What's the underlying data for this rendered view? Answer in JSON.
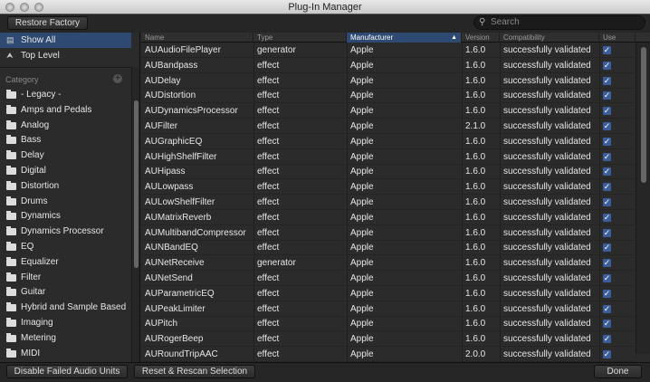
{
  "window": {
    "title": "Plug-In Manager"
  },
  "toolbar": {
    "restore_label": "Restore Factory",
    "search_placeholder": "Search"
  },
  "sidebar": {
    "top_items": [
      {
        "label": "Show All",
        "icon": "drive-icon"
      },
      {
        "label": "Top Level",
        "icon": "up-level-icon"
      }
    ],
    "category_label": "Category",
    "categories": [
      "- Legacy -",
      "Amps and Pedals",
      "Analog",
      "Bass",
      "Delay",
      "Digital",
      "Distortion",
      "Drums",
      "Dynamics",
      "Dynamics Processor",
      "EQ",
      "Equalizer",
      "Filter",
      "Guitar",
      "Hybrid and Sample Based",
      "Imaging",
      "Metering",
      "MIDI"
    ]
  },
  "table": {
    "columns": [
      "Name",
      "Type",
      "Manufacturer",
      "Version",
      "Compatibility",
      "Use"
    ],
    "sort_indicator": "▲",
    "rows": [
      [
        "AUAudioFilePlayer",
        "generator",
        "Apple",
        "1.6.0",
        "successfully validated"
      ],
      [
        "AUBandpass",
        "effect",
        "Apple",
        "1.6.0",
        "successfully validated"
      ],
      [
        "AUDelay",
        "effect",
        "Apple",
        "1.6.0",
        "successfully validated"
      ],
      [
        "AUDistortion",
        "effect",
        "Apple",
        "1.6.0",
        "successfully validated"
      ],
      [
        "AUDynamicsProcessor",
        "effect",
        "Apple",
        "1.6.0",
        "successfully validated"
      ],
      [
        "AUFilter",
        "effect",
        "Apple",
        "2.1.0",
        "successfully validated"
      ],
      [
        "AUGraphicEQ",
        "effect",
        "Apple",
        "1.6.0",
        "successfully validated"
      ],
      [
        "AUHighShelfFilter",
        "effect",
        "Apple",
        "1.6.0",
        "successfully validated"
      ],
      [
        "AUHipass",
        "effect",
        "Apple",
        "1.6.0",
        "successfully validated"
      ],
      [
        "AULowpass",
        "effect",
        "Apple",
        "1.6.0",
        "successfully validated"
      ],
      [
        "AULowShelfFilter",
        "effect",
        "Apple",
        "1.6.0",
        "successfully validated"
      ],
      [
        "AUMatrixReverb",
        "effect",
        "Apple",
        "1.6.0",
        "successfully validated"
      ],
      [
        "AUMultibandCompressor",
        "effect",
        "Apple",
        "1.6.0",
        "successfully validated"
      ],
      [
        "AUNBandEQ",
        "effect",
        "Apple",
        "1.6.0",
        "successfully validated"
      ],
      [
        "AUNetReceive",
        "generator",
        "Apple",
        "1.6.0",
        "successfully validated"
      ],
      [
        "AUNetSend",
        "effect",
        "Apple",
        "1.6.0",
        "successfully validated"
      ],
      [
        "AUParametricEQ",
        "effect",
        "Apple",
        "1.6.0",
        "successfully validated"
      ],
      [
        "AUPeakLimiter",
        "effect",
        "Apple",
        "1.6.0",
        "successfully validated"
      ],
      [
        "AUPitch",
        "effect",
        "Apple",
        "1.6.0",
        "successfully validated"
      ],
      [
        "AURogerBeep",
        "effect",
        "Apple",
        "1.6.0",
        "successfully validated"
      ],
      [
        "AURoundTripAAC",
        "effect",
        "Apple",
        "2.0.0",
        "successfully validated"
      ]
    ]
  },
  "bottom": {
    "disable_label": "Disable Failed Audio Units",
    "rescan_label": "Reset & Rescan Selection",
    "done_label": "Done"
  },
  "colors": {
    "selection": "#2e4a72",
    "checkbox": "#3b5d99"
  }
}
